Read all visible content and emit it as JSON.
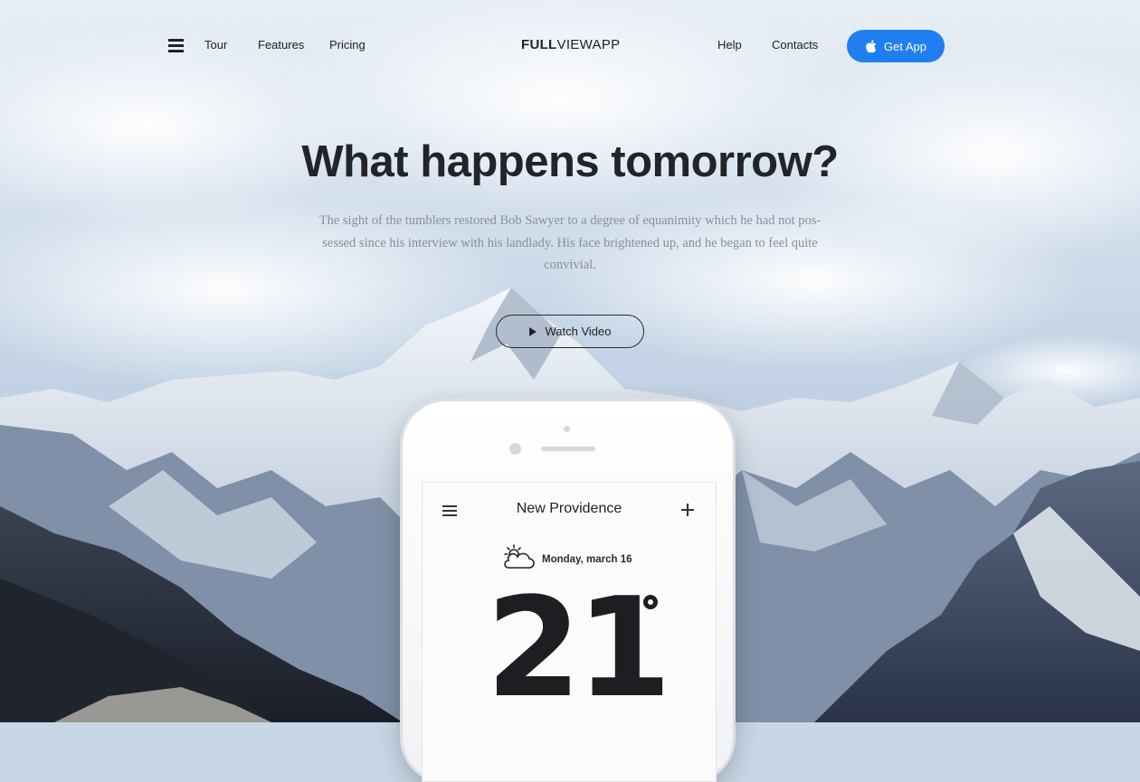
{
  "nav": {
    "left_links": [
      "Tour",
      "Features",
      "Pricing"
    ],
    "brand_bold": "FULL",
    "brand_rest": "VIEWAPP",
    "right_links": [
      "Help",
      "Contacts"
    ],
    "cta_label": "Get App",
    "cta_color": "#1f7ff0"
  },
  "hero": {
    "title": "What happens tomorrow?",
    "text_line1": "The sight of the tumblers restored Bob Sawyer to a degree of equanimity which he had not pos-",
    "text_line2": "sessed since his interview with his landlady. His face brightened up, and he began to feel quite",
    "text_line3": "convivial.",
    "video_button": "Watch Video"
  },
  "phone": {
    "city": "New Providence",
    "date": "Monday, march 16",
    "temperature": "21",
    "weather_icon": "partly-cloudy-icon"
  }
}
